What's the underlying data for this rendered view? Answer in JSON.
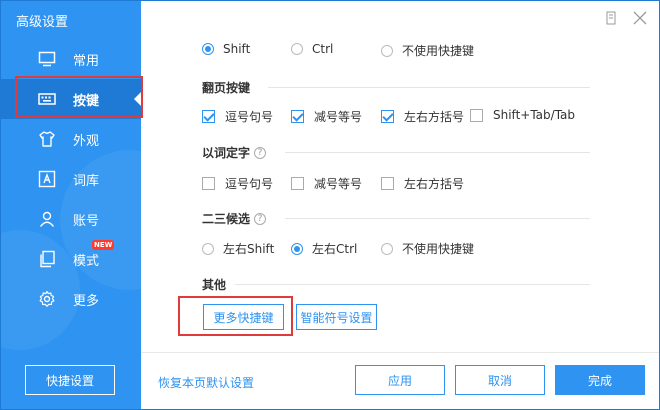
{
  "app": {
    "title": "高级设置"
  },
  "sidebar": {
    "items": [
      {
        "label": "常用",
        "icon": "monitor-icon"
      },
      {
        "label": "按键",
        "icon": "keyboard-icon",
        "active": true
      },
      {
        "label": "外观",
        "icon": "tshirt-icon"
      },
      {
        "label": "词库",
        "icon": "letter-a-icon"
      },
      {
        "label": "账号",
        "icon": "user-icon"
      },
      {
        "label": "模式",
        "icon": "pages-icon",
        "badge": "NEW"
      },
      {
        "label": "更多",
        "icon": "gear-icon"
      }
    ],
    "quick_settings_label": "快捷设置"
  },
  "switch_row": {
    "options": [
      "Shift",
      "Ctrl",
      "不使用快捷键"
    ],
    "selected": "Shift"
  },
  "paging_keys": {
    "title": "翻页按键",
    "options": [
      {
        "label": "逗号句号",
        "checked": true
      },
      {
        "label": "减号等号",
        "checked": true
      },
      {
        "label": "左右方括号",
        "checked": true
      },
      {
        "label": "Shift+Tab/Tab",
        "checked": false
      }
    ]
  },
  "word_select": {
    "title": "以词定字",
    "help": "?",
    "options": [
      {
        "label": "逗号句号",
        "checked": false
      },
      {
        "label": "减号等号",
        "checked": false
      },
      {
        "label": "左右方括号",
        "checked": false
      }
    ]
  },
  "candidate_23": {
    "title": "二三候选",
    "help": "?",
    "options": [
      "左右Shift",
      "左右Ctrl",
      "不使用快捷键"
    ],
    "selected": "左右Ctrl"
  },
  "other": {
    "title": "其他",
    "more_shortcuts_label": "更多快捷键",
    "smart_symbol_label": "智能符号设置"
  },
  "footer": {
    "reset_label": "恢复本页默认设置",
    "apply_label": "应用",
    "cancel_label": "取消",
    "done_label": "完成"
  },
  "colors": {
    "accent": "#2e93f1",
    "sidebar_active": "#1f7ad6",
    "highlight_box": "#e03b3b"
  }
}
